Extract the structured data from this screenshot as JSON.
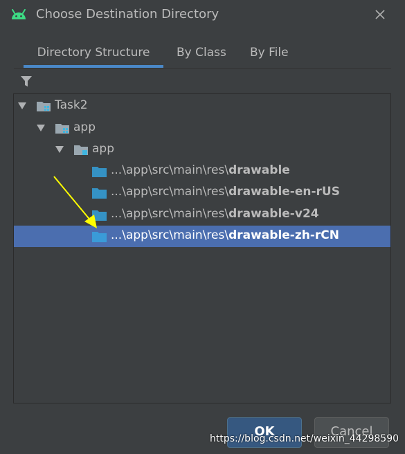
{
  "window": {
    "title": "Choose Destination Directory"
  },
  "tabs": [
    {
      "label": "Directory Structure",
      "active": true
    },
    {
      "label": "By Class",
      "active": false
    },
    {
      "label": "By File",
      "active": false
    }
  ],
  "tree": {
    "items": [
      {
        "label": "Task2",
        "expanded": true,
        "icon": "module-folder-icon"
      },
      {
        "label": "app",
        "expanded": true,
        "icon": "module-folder-icon"
      },
      {
        "label": "app",
        "expanded": true,
        "icon": "source-folder-icon"
      },
      {
        "prefix": "...\\app\\src\\main\\res\\",
        "name": "drawable",
        "icon": "folder-icon"
      },
      {
        "prefix": "...\\app\\src\\main\\res\\",
        "name": "drawable-en-rUS",
        "icon": "folder-icon"
      },
      {
        "prefix": "...\\app\\src\\main\\res\\",
        "name": "drawable-v24",
        "icon": "folder-icon"
      },
      {
        "prefix": "...\\app\\src\\main\\res\\",
        "name": "drawable-zh-rCN",
        "icon": "folder-icon",
        "selected": true
      }
    ]
  },
  "buttons": {
    "ok": "OK",
    "cancel": "Cancel"
  },
  "watermark": "https://blog.csdn.net/weixin_44298590",
  "colors": {
    "background": "#3c3f41",
    "selection": "#4b6eaf",
    "tab_underline": "#4a88c7",
    "annotation_arrow": "#ffff00"
  }
}
